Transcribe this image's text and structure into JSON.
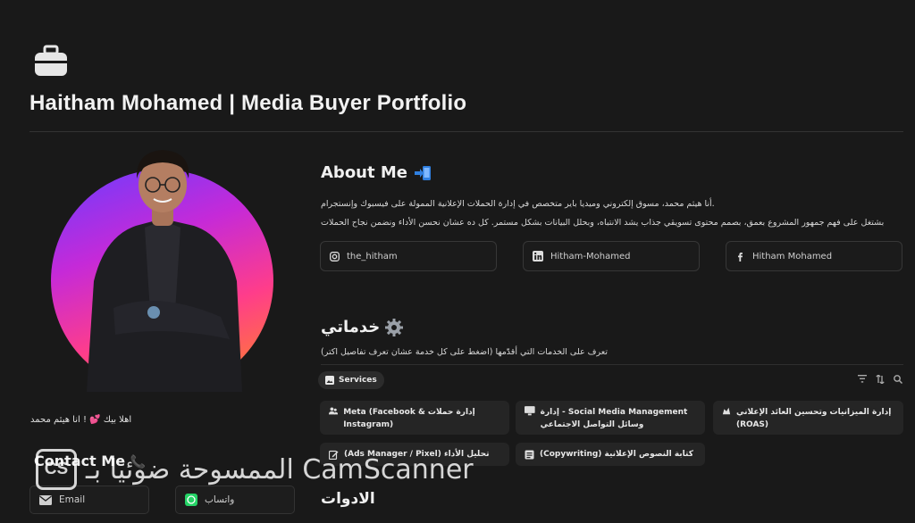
{
  "page": {
    "icon": "briefcase-icon",
    "title": "Haitham Mohamed | Media Buyer Portfolio"
  },
  "profile": {
    "greeting": "اهلا بيك 💕 ! انا هيثم محمد"
  },
  "contact": {
    "title": "Contact Me",
    "title_icon": "phone-icon",
    "email_label": "Email",
    "whatsapp_label": "واتساب"
  },
  "about": {
    "title": "About Me",
    "title_icon": "arrow-into-phone-icon",
    "line1": ".أنا هيثم محمد، مسوق إلكتروني وميديا باير متخصص في إدارة الحملات الإعلانية الممولة على فيسبوك وإنستجرام",
    "line2": "بشتغل على فهم جمهور المشروع بعمق، بصمم محتوى تسويقي جذاب يشد الانتباه، وبحلل البيانات بشكل مستمر. كل ده عشان نحسن الأداء ونضمن نجاح الحملات",
    "socials": [
      {
        "icon": "instagram-icon",
        "label": "the_hitham"
      },
      {
        "icon": "linkedin-icon",
        "label": "Hitham-Mohamed"
      },
      {
        "icon": "facebook-icon",
        "label": "Hitham Mohamed"
      }
    ]
  },
  "services": {
    "title": "خدماتي",
    "title_icon": "gear-icon",
    "subtitle": "تعرف على الخدمات التي أقدّمها (اضغط على كل خدمة عشان تعرف تفاصيل اكتر)",
    "view_tab": "Services",
    "cards": [
      {
        "icon": "people-icon",
        "label": "إدارة حملات Meta (Facebook & Instagram)"
      },
      {
        "icon": "monitor-icon",
        "label": "Social Media Management - إدارة وسائل التواصل الاجتماعي"
      },
      {
        "icon": "budget-icon",
        "label": "إدارة الميزانيات وتحسين العائد الإعلاني (ROAS)"
      },
      {
        "icon": "pencil-icon",
        "label": "تحليل الأداء (Ads Manager / Pixel)"
      },
      {
        "icon": "document-icon",
        "label": "كتابة النصوص الإعلانية (Copywriting)"
      }
    ]
  },
  "tools": {
    "title": "الادوات"
  },
  "watermark": {
    "logo": "CS",
    "text": "الممسوحة ضوئيا بـ CamScanner"
  },
  "colors": {
    "background": "#191919",
    "card": "#252525",
    "whatsapp": "#25d366"
  }
}
